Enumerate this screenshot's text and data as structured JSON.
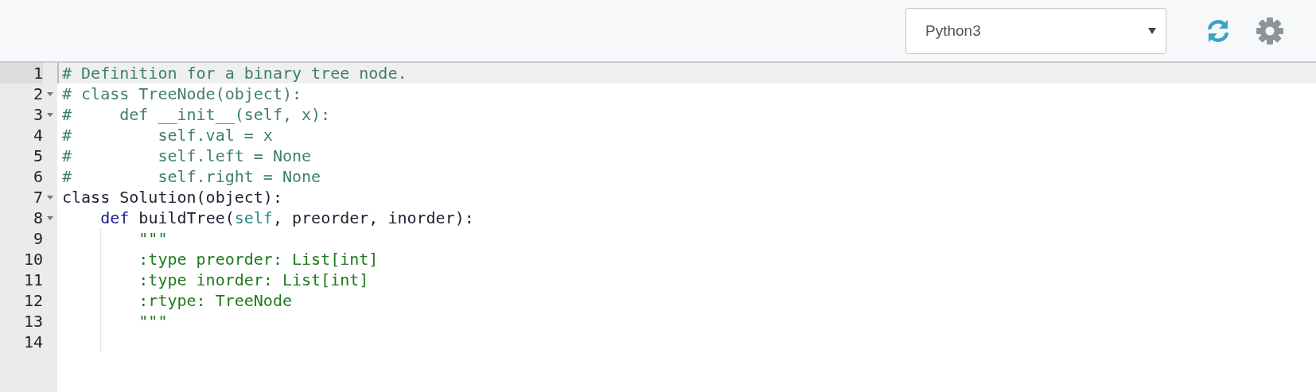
{
  "toolbar": {
    "language_select": {
      "value": "Python3"
    }
  },
  "editor": {
    "lines": [
      {
        "number": "1",
        "active": true,
        "foldable": false,
        "tokens": [
          {
            "kind": "comment",
            "text": "# Definition for a binary tree node."
          }
        ]
      },
      {
        "number": "2",
        "active": false,
        "foldable": true,
        "tokens": [
          {
            "kind": "comment",
            "text": "# class TreeNode(object):"
          }
        ]
      },
      {
        "number": "3",
        "active": false,
        "foldable": true,
        "tokens": [
          {
            "kind": "comment",
            "text": "#     def __init__(self, x):"
          }
        ]
      },
      {
        "number": "4",
        "active": false,
        "foldable": false,
        "tokens": [
          {
            "kind": "comment",
            "text": "#         self.val = x"
          }
        ]
      },
      {
        "number": "5",
        "active": false,
        "foldable": false,
        "tokens": [
          {
            "kind": "comment",
            "text": "#         self.left = None"
          }
        ]
      },
      {
        "number": "6",
        "active": false,
        "foldable": false,
        "tokens": [
          {
            "kind": "comment",
            "text": "#         self.right = None"
          }
        ]
      },
      {
        "number": "7",
        "active": false,
        "foldable": true,
        "tokens": [
          {
            "kind": "plain",
            "text": "class Solution(object):"
          }
        ]
      },
      {
        "number": "8",
        "active": false,
        "foldable": true,
        "tokens": [
          {
            "kind": "keyword",
            "text": "    def"
          },
          {
            "kind": "plain",
            "text": " buildTree("
          },
          {
            "kind": "builtin",
            "text": "self"
          },
          {
            "kind": "plain",
            "text": ", preorder, inorder):"
          }
        ]
      },
      {
        "number": "9",
        "active": false,
        "foldable": false,
        "tokens": [
          {
            "kind": "string",
            "text": "        \"\"\""
          }
        ]
      },
      {
        "number": "10",
        "active": false,
        "foldable": false,
        "tokens": [
          {
            "kind": "string",
            "text": "        :type preorder: List[int]"
          }
        ]
      },
      {
        "number": "11",
        "active": false,
        "foldable": false,
        "tokens": [
          {
            "kind": "string",
            "text": "        :type inorder: List[int]"
          }
        ]
      },
      {
        "number": "12",
        "active": false,
        "foldable": false,
        "tokens": [
          {
            "kind": "string",
            "text": "        :rtype: TreeNode"
          }
        ]
      },
      {
        "number": "13",
        "active": false,
        "foldable": false,
        "tokens": [
          {
            "kind": "string",
            "text": "        \"\"\""
          }
        ]
      },
      {
        "number": "14",
        "active": false,
        "foldable": false
      }
    ]
  }
}
